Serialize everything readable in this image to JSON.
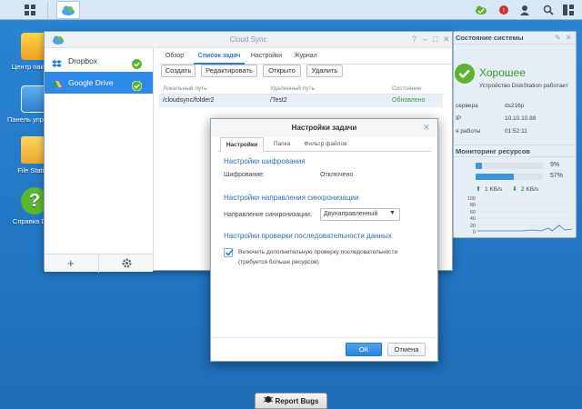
{
  "taskbar": {
    "main_menu": "main-menu-icon",
    "app": "cloud-sync-icon"
  },
  "desktop": {
    "icons": [
      {
        "label": "Центр пакетов"
      },
      {
        "label": "Панель управления"
      },
      {
        "label": "File Station"
      },
      {
        "label": "Справка DSM"
      }
    ]
  },
  "window": {
    "title": "Cloud Sync",
    "controls": [
      "?",
      "–",
      "□",
      "✕"
    ],
    "sidebar": [
      {
        "label": "Dropbox",
        "status": "ok"
      },
      {
        "label": "Google Drive",
        "status": "ok"
      }
    ],
    "tabs": [
      "Обзор",
      "Список задач",
      "Настройки",
      "Журнал"
    ],
    "toolbar": [
      "Создать",
      "Редактировать",
      "Открыто",
      "Удалить"
    ],
    "table": {
      "columns": [
        "Локальный путь",
        "Удаленный путь",
        "Состояние"
      ],
      "rows": [
        [
          "/cloudsync/folder2",
          "/Test2",
          "Обновлено"
        ]
      ]
    }
  },
  "status_widget": {
    "title": "Состояние системы",
    "health": "Хорошее",
    "health_desc": "Устройство DiskStation работает",
    "rows": [
      {
        "label": "сервера",
        "value": "ds216p"
      },
      {
        "label": "IP",
        "value": "10.10.10.88"
      },
      {
        "label": "я работы",
        "value": "01:52:11"
      }
    ]
  },
  "monitor_widget": {
    "title": "Мониторинг ресурсов",
    "cpu_percent": 9,
    "ram_percent": 57,
    "cpu_label": "9%",
    "ram_label": "57%",
    "upload": "1 KB/s",
    "download": "2 KB/s",
    "y_ticks": [
      "100",
      "80",
      "60",
      "40",
      "20",
      "0"
    ]
  },
  "dialog": {
    "title": "Настройки задачи",
    "tabs": [
      "Настройки",
      "Папка",
      "Фильтр файлов"
    ],
    "encryption_title": "Настройки шифрования",
    "encryption_label": "Шифрование:",
    "encryption_value": "Отключено",
    "direction_title": "Настройки направления синхронизации",
    "direction_label": "Направление синхронизации:",
    "direction_value": "Двунаправленный",
    "consistency_title": "Настройки проверки последовательности данных",
    "consistency_check": "Включить дополнительную проверку последовательности",
    "consistency_note": "(требуется больше ресурсов)",
    "ok": "ОК",
    "cancel": "Отмена"
  },
  "report_bugs": "Report Bugs"
}
